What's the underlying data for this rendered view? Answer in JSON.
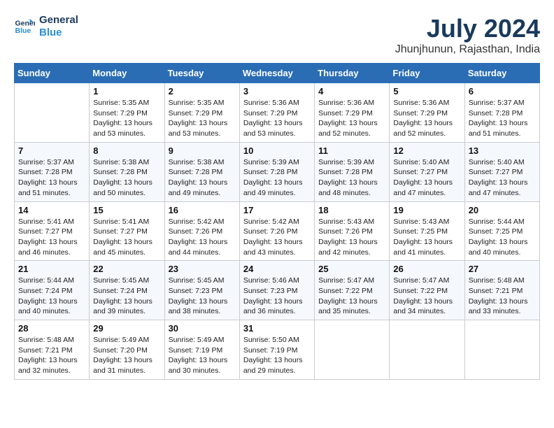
{
  "header": {
    "logo_line1": "General",
    "logo_line2": "Blue",
    "month": "July 2024",
    "location": "Jhunjhunun, Rajasthan, India"
  },
  "days_of_week": [
    "Sunday",
    "Monday",
    "Tuesday",
    "Wednesday",
    "Thursday",
    "Friday",
    "Saturday"
  ],
  "weeks": [
    [
      {
        "day": "",
        "text": ""
      },
      {
        "day": "1",
        "text": "Sunrise: 5:35 AM\nSunset: 7:29 PM\nDaylight: 13 hours\nand 53 minutes."
      },
      {
        "day": "2",
        "text": "Sunrise: 5:35 AM\nSunset: 7:29 PM\nDaylight: 13 hours\nand 53 minutes."
      },
      {
        "day": "3",
        "text": "Sunrise: 5:36 AM\nSunset: 7:29 PM\nDaylight: 13 hours\nand 53 minutes."
      },
      {
        "day": "4",
        "text": "Sunrise: 5:36 AM\nSunset: 7:29 PM\nDaylight: 13 hours\nand 52 minutes."
      },
      {
        "day": "5",
        "text": "Sunrise: 5:36 AM\nSunset: 7:29 PM\nDaylight: 13 hours\nand 52 minutes."
      },
      {
        "day": "6",
        "text": "Sunrise: 5:37 AM\nSunset: 7:28 PM\nDaylight: 13 hours\nand 51 minutes."
      }
    ],
    [
      {
        "day": "7",
        "text": "Sunrise: 5:37 AM\nSunset: 7:28 PM\nDaylight: 13 hours\nand 51 minutes."
      },
      {
        "day": "8",
        "text": "Sunrise: 5:38 AM\nSunset: 7:28 PM\nDaylight: 13 hours\nand 50 minutes."
      },
      {
        "day": "9",
        "text": "Sunrise: 5:38 AM\nSunset: 7:28 PM\nDaylight: 13 hours\nand 49 minutes."
      },
      {
        "day": "10",
        "text": "Sunrise: 5:39 AM\nSunset: 7:28 PM\nDaylight: 13 hours\nand 49 minutes."
      },
      {
        "day": "11",
        "text": "Sunrise: 5:39 AM\nSunset: 7:28 PM\nDaylight: 13 hours\nand 48 minutes."
      },
      {
        "day": "12",
        "text": "Sunrise: 5:40 AM\nSunset: 7:27 PM\nDaylight: 13 hours\nand 47 minutes."
      },
      {
        "day": "13",
        "text": "Sunrise: 5:40 AM\nSunset: 7:27 PM\nDaylight: 13 hours\nand 47 minutes."
      }
    ],
    [
      {
        "day": "14",
        "text": "Sunrise: 5:41 AM\nSunset: 7:27 PM\nDaylight: 13 hours\nand 46 minutes."
      },
      {
        "day": "15",
        "text": "Sunrise: 5:41 AM\nSunset: 7:27 PM\nDaylight: 13 hours\nand 45 minutes."
      },
      {
        "day": "16",
        "text": "Sunrise: 5:42 AM\nSunset: 7:26 PM\nDaylight: 13 hours\nand 44 minutes."
      },
      {
        "day": "17",
        "text": "Sunrise: 5:42 AM\nSunset: 7:26 PM\nDaylight: 13 hours\nand 43 minutes."
      },
      {
        "day": "18",
        "text": "Sunrise: 5:43 AM\nSunset: 7:26 PM\nDaylight: 13 hours\nand 42 minutes."
      },
      {
        "day": "19",
        "text": "Sunrise: 5:43 AM\nSunset: 7:25 PM\nDaylight: 13 hours\nand 41 minutes."
      },
      {
        "day": "20",
        "text": "Sunrise: 5:44 AM\nSunset: 7:25 PM\nDaylight: 13 hours\nand 40 minutes."
      }
    ],
    [
      {
        "day": "21",
        "text": "Sunrise: 5:44 AM\nSunset: 7:24 PM\nDaylight: 13 hours\nand 40 minutes."
      },
      {
        "day": "22",
        "text": "Sunrise: 5:45 AM\nSunset: 7:24 PM\nDaylight: 13 hours\nand 39 minutes."
      },
      {
        "day": "23",
        "text": "Sunrise: 5:45 AM\nSunset: 7:23 PM\nDaylight: 13 hours\nand 38 minutes."
      },
      {
        "day": "24",
        "text": "Sunrise: 5:46 AM\nSunset: 7:23 PM\nDaylight: 13 hours\nand 36 minutes."
      },
      {
        "day": "25",
        "text": "Sunrise: 5:47 AM\nSunset: 7:22 PM\nDaylight: 13 hours\nand 35 minutes."
      },
      {
        "day": "26",
        "text": "Sunrise: 5:47 AM\nSunset: 7:22 PM\nDaylight: 13 hours\nand 34 minutes."
      },
      {
        "day": "27",
        "text": "Sunrise: 5:48 AM\nSunset: 7:21 PM\nDaylight: 13 hours\nand 33 minutes."
      }
    ],
    [
      {
        "day": "28",
        "text": "Sunrise: 5:48 AM\nSunset: 7:21 PM\nDaylight: 13 hours\nand 32 minutes."
      },
      {
        "day": "29",
        "text": "Sunrise: 5:49 AM\nSunset: 7:20 PM\nDaylight: 13 hours\nand 31 minutes."
      },
      {
        "day": "30",
        "text": "Sunrise: 5:49 AM\nSunset: 7:19 PM\nDaylight: 13 hours\nand 30 minutes."
      },
      {
        "day": "31",
        "text": "Sunrise: 5:50 AM\nSunset: 7:19 PM\nDaylight: 13 hours\nand 29 minutes."
      },
      {
        "day": "",
        "text": ""
      },
      {
        "day": "",
        "text": ""
      },
      {
        "day": "",
        "text": ""
      }
    ]
  ]
}
